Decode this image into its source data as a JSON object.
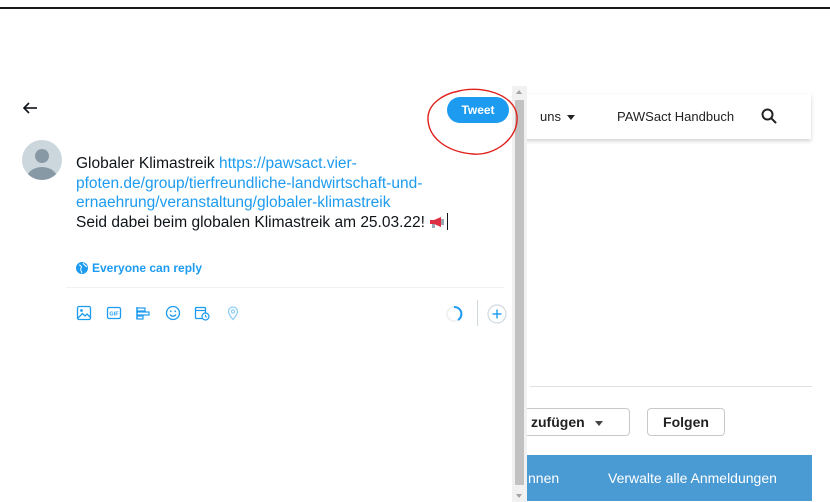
{
  "compose": {
    "tweet_button": "Tweet",
    "text_prefix": "Globaler Klimastreik ",
    "link": "https://pawsact.vier-pfoten.de/group/tierfreundliche-landwirtschaft-und-ernaehrung/veranstaltung/globaler-klimastreik",
    "text_line2": "Seid dabei beim globalen Klimastreik am 25.03.22! ",
    "reply_setting": "Everyone can reply",
    "toolbar_icons": [
      "image-icon",
      "gif-icon",
      "poll-icon",
      "emoji-icon",
      "schedule-icon",
      "location-icon"
    ]
  },
  "background_page": {
    "nav_item_1": "uns",
    "nav_item_2": "PAWSact Handbuch",
    "add_button": "zufügen",
    "follow_button": "Folgen",
    "bar_item_1": "nnen",
    "bar_item_2": "Verwalte alle Anmeldungen"
  },
  "colors": {
    "twitter_blue": "#1d9bf0",
    "annotation_red": "#e0201b",
    "bar_blue": "#4a9ad4"
  }
}
